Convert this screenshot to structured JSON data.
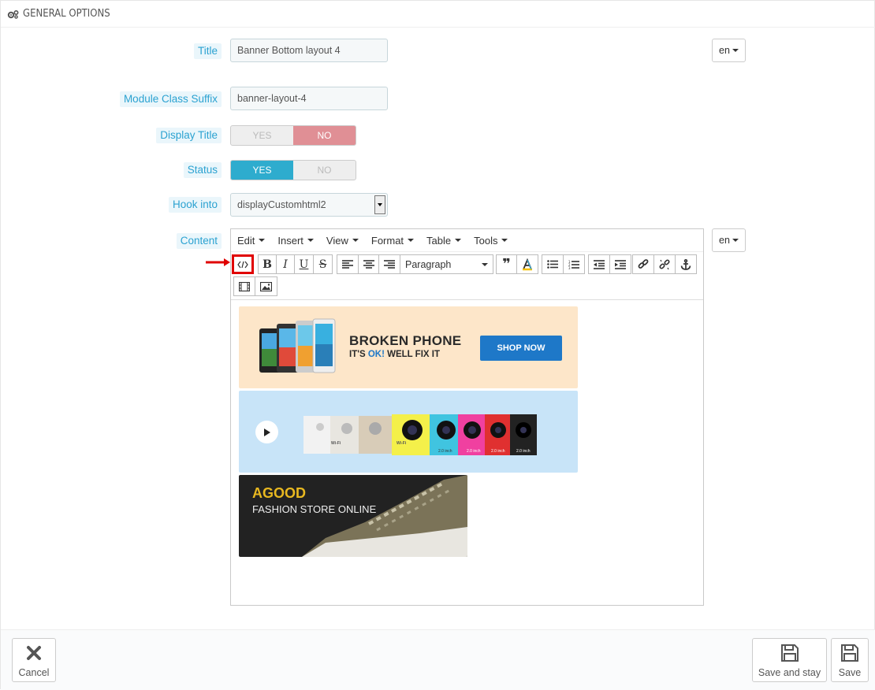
{
  "panel": {
    "heading": "GENERAL OPTIONS"
  },
  "form": {
    "title_label": "Title",
    "title_value": "Banner Bottom layout 4",
    "lang": "en",
    "suffix_label": "Module Class Suffix",
    "suffix_value": "banner-layout-4",
    "display_title_label": "Display Title",
    "display_title": {
      "yes": "YES",
      "no": "NO",
      "selected": "NO"
    },
    "status_label": "Status",
    "status": {
      "yes": "YES",
      "no": "NO",
      "selected": "YES"
    },
    "hook_label": "Hook into",
    "hook_value": "displayCustomhtml2",
    "content_label": "Content",
    "content_lang": "en"
  },
  "editor": {
    "menus": [
      "Edit",
      "Insert",
      "View",
      "Format",
      "Table",
      "Tools"
    ],
    "format_select": "Paragraph",
    "banners": {
      "phone_title": "BROKEN PHONE",
      "phone_sub_a": "IT'S ",
      "phone_sub_ok": "OK!",
      "phone_sub_b": " WELL FIX IT",
      "phone_cta": "SHOP NOW",
      "camera_labels": [
        "Wi-Fi",
        "Wi-Fi",
        "2.0 inch",
        "2.0 inch",
        "2.0 inch",
        "2.0 inch"
      ],
      "fashion_title": "AGOOD",
      "fashion_sub": "FASHION STORE ONLINE"
    }
  },
  "footer": {
    "cancel": "Cancel",
    "save_stay": "Save and stay",
    "save": "Save"
  },
  "colors": {
    "accent": "#2eacce",
    "danger": "#e08f95",
    "highlight": "#e00000"
  }
}
